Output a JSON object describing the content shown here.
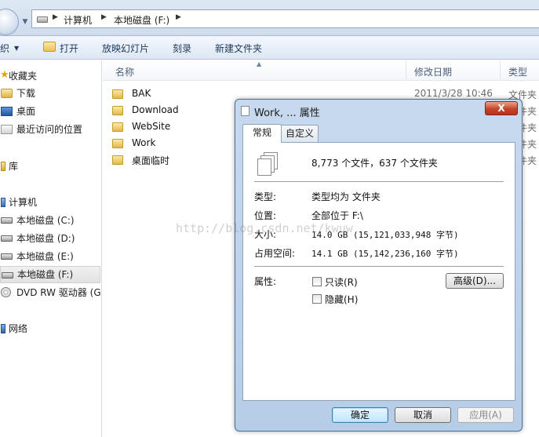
{
  "address_bar": {
    "path": [
      "计算机",
      "本地磁盘 (F:)"
    ]
  },
  "toolbar": {
    "organize_label": "织",
    "open_label": "打开",
    "slideshow_label": "放映幻灯片",
    "burn_label": "刻录",
    "new_folder_label": "新建文件夹"
  },
  "sidebar": {
    "favorites_label": "收藏夹",
    "downloads_label": "下载",
    "desktop_label": "桌面",
    "recent_label": "最近访问的位置",
    "libraries_label": "库",
    "computer_label": "计算机",
    "drive_c": "本地磁盘 (C:)",
    "drive_d": "本地磁盘 (D:)",
    "drive_e": "本地磁盘 (E:)",
    "drive_f": "本地磁盘 (F:)",
    "dvd": "DVD RW 驱动器 (G",
    "network_label": "网络"
  },
  "filelist": {
    "columns": {
      "name": "名称",
      "date": "修改日期",
      "type": "类型"
    },
    "rows": [
      {
        "name": "BAK",
        "date": "2011/3/28 10:46",
        "type": "文件夹"
      },
      {
        "name": "Download",
        "date": "",
        "type": "文件夹"
      },
      {
        "name": "WebSite",
        "date": "",
        "type": "文件夹"
      },
      {
        "name": "Work",
        "date": "",
        "type": "文件夹"
      },
      {
        "name": "桌面临时",
        "date": "",
        "type": "文件夹"
      }
    ]
  },
  "dialog": {
    "title": "Work, ... 属性",
    "close_label": "X",
    "tab_general": "常规",
    "tab_custom": "自定义",
    "summary": "8,773 个文件，637 个文件夹",
    "type_label": "类型:",
    "type_value": "类型均为 文件夹",
    "location_label": "位置:",
    "location_value": "全部位于 F:\\",
    "size_label": "大小:",
    "size_value": "14.0 GB (15,121,033,948 字节)",
    "size_on_disk_label": "占用空间:",
    "size_on_disk_value": "14.1 GB (15,142,236,160 字节)",
    "attributes_label": "属性:",
    "readonly_label": "只读(R)",
    "hidden_label": "隐藏(H)",
    "advanced_label": "高级(D)...",
    "ok_label": "确定",
    "cancel_label": "取消",
    "apply_label": "应用(A)"
  },
  "watermark": "http://blog.csdn.net/kwuw"
}
